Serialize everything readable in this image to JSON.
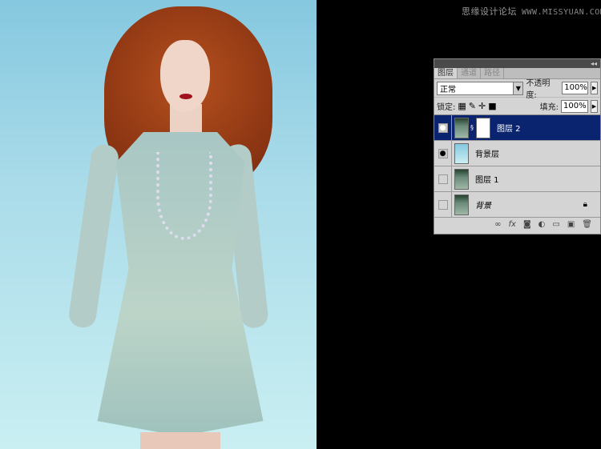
{
  "watermark": {
    "cn": "思缘设计论坛",
    "site": "WWW.MISSYUAN.COM"
  },
  "panel": {
    "collapse": "◂◂",
    "tabs": [
      "图层",
      "通道",
      "路径"
    ],
    "blend_mode": "正常",
    "opacity_label": "不透明度:",
    "opacity": "100%",
    "lock_label": "锁定:",
    "fill_label": "填充:",
    "fill": "100%",
    "layers": [
      {
        "name": "图层 2",
        "visible": true,
        "selected": true
      },
      {
        "name": "背景层",
        "visible": true,
        "selected": false
      },
      {
        "name": "图层 1",
        "visible": false,
        "selected": false
      },
      {
        "name": "背景",
        "visible": false,
        "selected": false,
        "locked": true
      }
    ],
    "footer_icons": [
      "link-icon",
      "fx-icon",
      "mask-icon",
      "adjustment-icon",
      "group-icon",
      "new-layer-icon",
      "trash-icon"
    ]
  }
}
